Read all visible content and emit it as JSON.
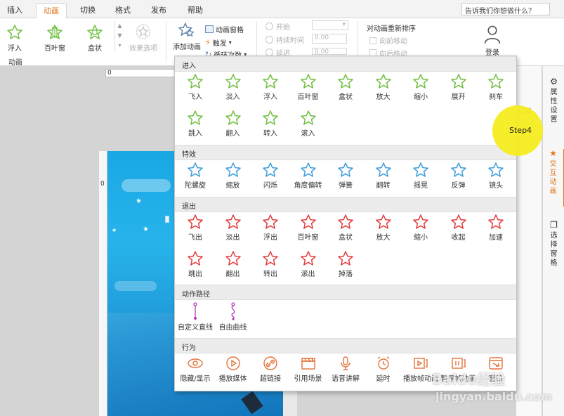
{
  "menu": {
    "tabs": [
      "插入",
      "动画",
      "切换",
      "格式",
      "发布",
      "帮助"
    ],
    "active_tab": "动画",
    "search_placeholder": "告诉我们你想做什么？"
  },
  "ribbon": {
    "quick_effects": [
      "浮入",
      "百叶窗",
      "盒状"
    ],
    "effect_options": "效果选项",
    "group_label": "动画",
    "add_animation": "添加动画",
    "animation_pane": "动画窗格",
    "trigger": "触发",
    "loop_count": "循环次数",
    "start_label": "开始",
    "duration_label": "持续时间",
    "duration_value": "0.00",
    "delay_label": "延迟",
    "delay_value": "0.00",
    "reorder_title": "对动画重新排序",
    "move_earlier": "向前移动",
    "move_later": "向后移动",
    "login": "登录"
  },
  "ruler": {
    "top_value": "0",
    "left_value": "0"
  },
  "right_panel": {
    "items": [
      {
        "label": "属性设置",
        "icon": "gear-icon"
      },
      {
        "label": "交互动画",
        "icon": "star-icon"
      },
      {
        "label": "选择窗格",
        "icon": "layers-icon"
      }
    ],
    "active": "交互动画"
  },
  "bg_panel_label": "动画",
  "gallery": {
    "sections": [
      {
        "title": "进入",
        "color": "#6fbf3f",
        "items": [
          "飞入",
          "淡入",
          "浮入",
          "百叶窗",
          "盒状",
          "放大",
          "缩小",
          "展开",
          "刹车",
          "跳入",
          "翻入",
          "转入",
          "滚入"
        ]
      },
      {
        "title": "特效",
        "color": "#3f9ddb",
        "items": [
          "陀螺旋",
          "缩放",
          "闪烁",
          "角度偏转",
          "弹簧",
          "翻转",
          "摇晃",
          "反弹",
          "镜头"
        ]
      },
      {
        "title": "退出",
        "color": "#e23c3c",
        "items": [
          "飞出",
          "淡出",
          "浮出",
          "百叶窗",
          "盒状",
          "放大",
          "缩小",
          "收起",
          "加速",
          "跳出",
          "翻出",
          "转出",
          "滚出",
          "掉落"
        ]
      },
      {
        "title": "动作路径",
        "color": "#b23ab6",
        "items": [
          "自定义直线",
          "自由曲线"
        ]
      },
      {
        "title": "行为",
        "color": "#e4733a",
        "items": [
          {
            "label": "隐藏/显示",
            "icon": "eye-icon"
          },
          {
            "label": "播放媒体",
            "icon": "play-circle-icon"
          },
          {
            "label": "超链接",
            "icon": "link-icon"
          },
          {
            "label": "引用场景",
            "icon": "clapper-icon"
          },
          {
            "label": "语音讲解",
            "icon": "microphone-icon"
          },
          {
            "label": "延时",
            "icon": "alarm-clock-icon"
          },
          {
            "label": "播放帧动画",
            "icon": "play-frame-icon"
          },
          {
            "label": "暂停帧动画",
            "icon": "pause-frame-icon"
          },
          {
            "label": "窗口",
            "icon": "window-icon"
          }
        ]
      }
    ]
  },
  "step_marker": "Step4",
  "watermark": {
    "brand": "Baidu经验",
    "url": "jingyan.baidu.com"
  }
}
